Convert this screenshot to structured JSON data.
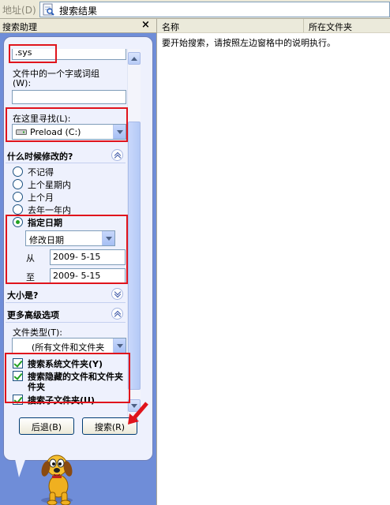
{
  "address_bar": {
    "label": "地址",
    "shortcut": "(D)",
    "value": "搜索结果"
  },
  "search_pane": {
    "title": "搜索助理",
    "close_glyph": "×",
    "filename_value": ".sys",
    "word_label": "文件中的一个字或词组",
    "word_shortcut": "(W):",
    "word_value": "",
    "lookin_label": "在这里寻找(L):",
    "lookin_value": "Preload (C:)",
    "modified_header": "什么时候修改的?",
    "date_options": [
      "不记得",
      "上个星期内",
      "上个月",
      "去年一年内",
      "指定日期"
    ],
    "date_selected": "指定日期",
    "date_type_value": "修改日期",
    "from_label": "从",
    "from_value": "2009- 5-15",
    "to_label": "至",
    "to_value": "2009- 5-15",
    "size_header": "大小是?",
    "advanced_header": "更多高级选项",
    "filetype_label": "文件类型(T):",
    "filetype_value": "(所有文件和文件夹",
    "checks": [
      {
        "label": "搜索系统文件夹(Y)",
        "checked": true
      },
      {
        "label": "搜索隐藏的文件和文件夹",
        "label2": "件夹",
        "checked": true
      },
      {
        "label": "搜索子文件夹(U)",
        "checked": true
      }
    ],
    "back_button": "后退(B)",
    "search_button": "搜索(R)"
  },
  "results": {
    "columns": [
      "名称",
      "所在文件夹"
    ],
    "message": "要开始搜索，请按照左边窗格中的说明执行。"
  },
  "icons": [
    "search-results-icon",
    "drive-icon",
    "dog-assistant-icon",
    "red-arrow-icon"
  ],
  "colors": {
    "pane_blue": "#6f8dd8",
    "balloon": "#eef1fd",
    "highlight_red": "#e0141c",
    "check_green": "#21a121"
  }
}
